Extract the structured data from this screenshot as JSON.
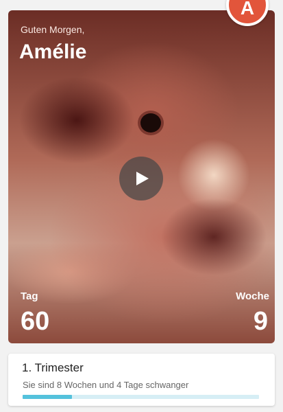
{
  "hero": {
    "greeting": "Guten Morgen,",
    "name": "Amélie",
    "day_label": "Tag",
    "day_value": "60",
    "week_label": "Woche",
    "week_value": "9"
  },
  "avatar": {
    "initial": "A",
    "color": "#e2553b"
  },
  "play_button": {
    "icon": "play-icon"
  },
  "trimester": {
    "title": "1. Trimester",
    "subtitle": "Sie sind 8 Wochen und 4 Tage schwanger",
    "progress": 0.21,
    "progress_color": "#54c2dc",
    "track_color": "#d6eef5"
  }
}
